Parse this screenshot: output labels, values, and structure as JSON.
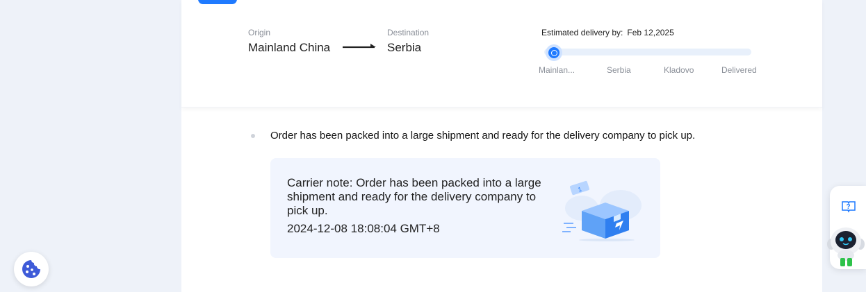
{
  "route": {
    "origin_label": "Origin",
    "origin_value": "Mainland China",
    "destination_label": "Destination",
    "destination_value": "Serbia"
  },
  "delivery": {
    "estimated_label": "Estimated delivery by:",
    "estimated_date": "Feb 12,2025"
  },
  "progress": {
    "current_stage_index": 0,
    "stages": [
      "Mainlan...",
      "Serbia",
      "Kladovo",
      "Delivered"
    ]
  },
  "event": {
    "text": "Order has been packed into a large shipment and ready for the delivery company to pick up."
  },
  "carrier_note": {
    "text": "Carrier note: Order has been packed into a large shipment and ready for the delivery company to pick up.",
    "timestamp": "2024-12-08 18:08:04 GMT+8"
  },
  "widgets": {
    "cookie_icon": "cookie-icon",
    "help_icon": "question-book-icon",
    "assistant_icon": "robot-assistant-icon"
  },
  "colors": {
    "accent": "#1f7aff",
    "track": "#e8f0fb",
    "note_bg": "#f1f5fe",
    "page_bg": "#eef2f9"
  }
}
